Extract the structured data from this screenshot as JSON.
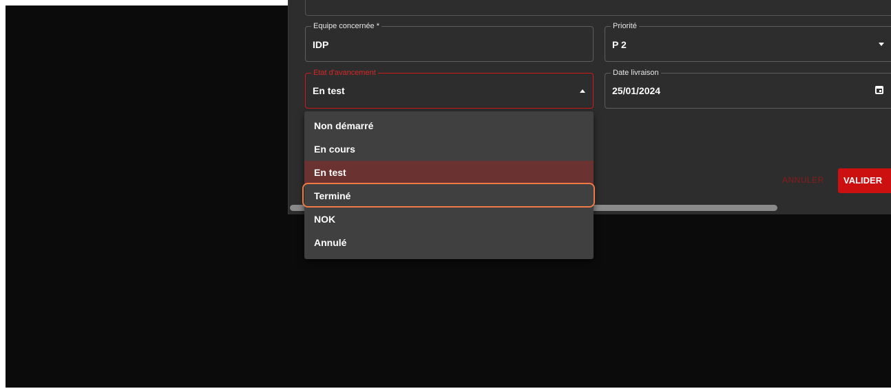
{
  "form": {
    "equipe": {
      "label": "Equipe concernée *",
      "value": "IDP"
    },
    "priorite": {
      "label": "Priorité",
      "value": "P 2"
    },
    "etat": {
      "label": "Etat d'avancement",
      "value": "En test"
    },
    "date_livraison": {
      "label": "Date livraison",
      "value": "25/01/2024"
    }
  },
  "actions": {
    "cancel_label": "ANNULER",
    "submit_label": "VALIDER"
  },
  "dropdown": {
    "options": [
      "Non démarré",
      "En cours",
      "En test",
      "Terminé",
      "NOK",
      "Annulé"
    ],
    "selected": "En test",
    "highlighted": "Terminé"
  },
  "colors": {
    "accent": "#cc1010",
    "selected_bg": "#6b3232",
    "highlight_ring": "#ef7a43"
  }
}
